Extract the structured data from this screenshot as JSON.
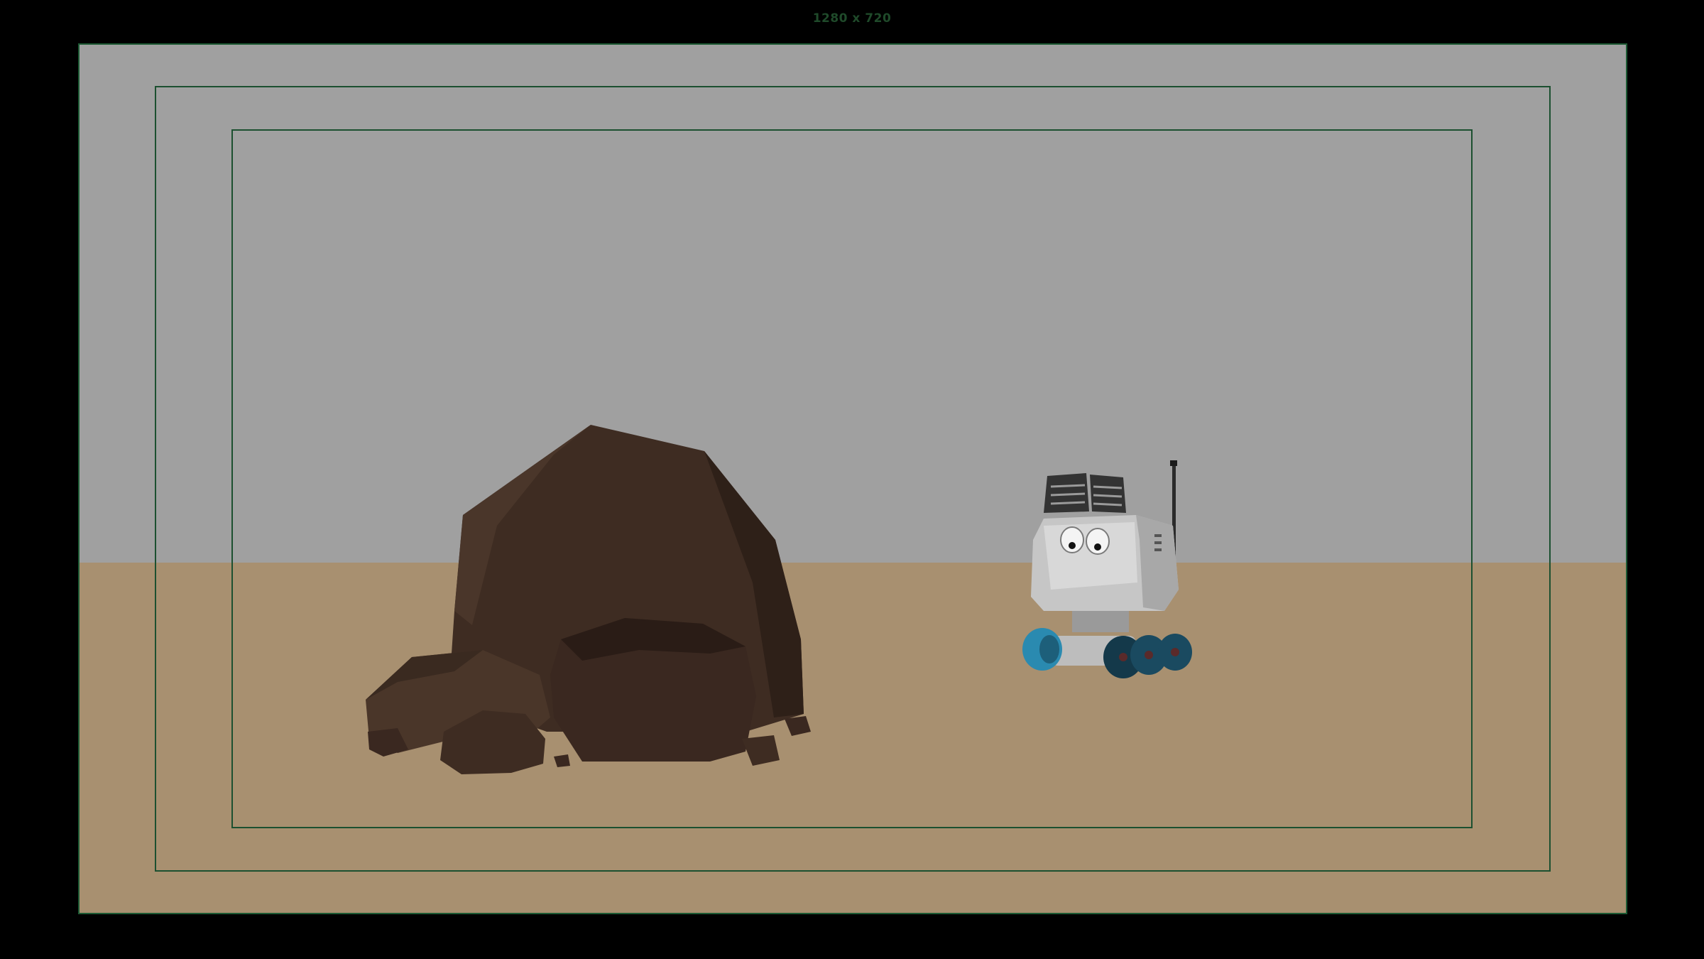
{
  "viewport": {
    "resolution_label": "1280 x 720"
  },
  "scene": {
    "sky_color": "#a0a0a0",
    "ground_color": "#a89070",
    "letterbox_color": "#000000",
    "gate_color": "#1c5030",
    "objects": [
      {
        "name": "rock",
        "color": "#3e2c22"
      },
      {
        "name": "robot",
        "color": "#c8c8c8",
        "accent": "#2a8ab0"
      }
    ]
  }
}
